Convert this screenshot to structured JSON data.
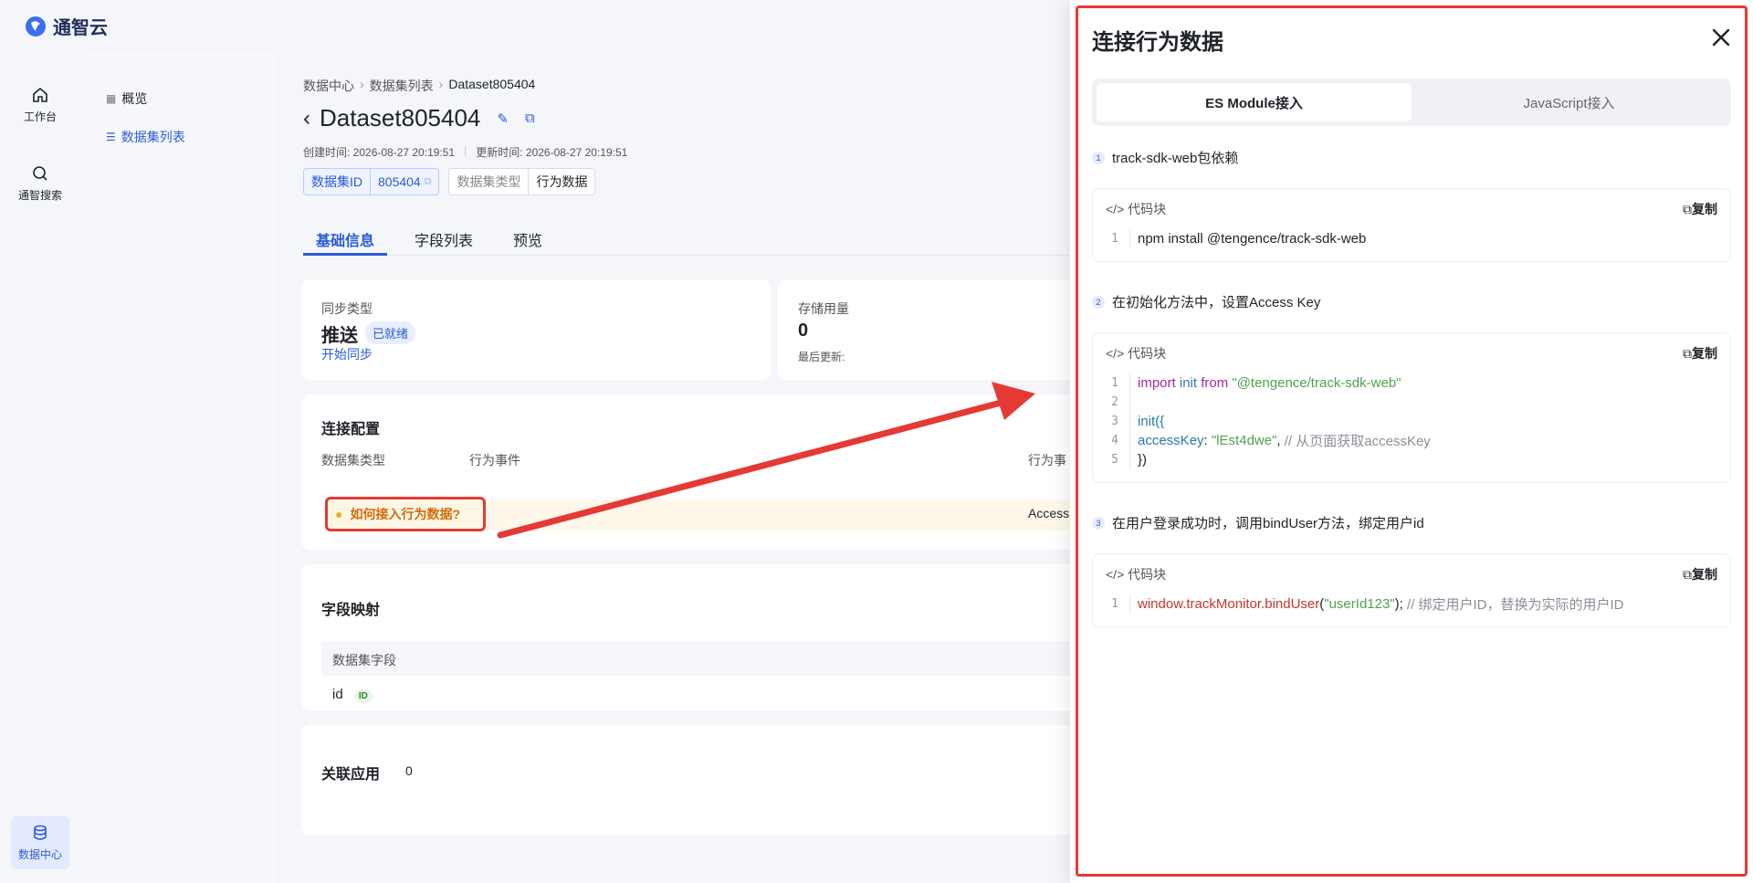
{
  "app": {
    "name": "通智云"
  },
  "rail": {
    "items": [
      {
        "label": "工作台",
        "icon": "home-icon"
      },
      {
        "label": "通智搜索",
        "icon": "search-icon"
      },
      {
        "label": "数据中心",
        "icon": "database-icon"
      }
    ]
  },
  "subnav": {
    "items": [
      "概览",
      "数据集列表"
    ]
  },
  "breadcrumb": [
    "数据中心",
    "数据集列表",
    "Dataset805404"
  ],
  "page": {
    "title": "Dataset805404",
    "created": "创建时间: 2026-08-27 20:19:51",
    "updated": "更新时间: 2026-08-27 20:19:51",
    "tag_id_key": "数据集ID",
    "tag_id_val": "805404",
    "tag_type_key": "数据集类型",
    "tag_type_val": "行为数据"
  },
  "tabs": [
    "基础信息",
    "字段列表",
    "预览"
  ],
  "sync": {
    "label": "同步类型",
    "value": "推送",
    "status": "已就绪",
    "action": "开始同步"
  },
  "storage": {
    "label": "存储用量",
    "value": "0",
    "last_update": "最后更新:"
  },
  "connect": {
    "title": "连接配置",
    "col_type": "数据集类型",
    "col_event": "行为事件",
    "col_event2": "行为事",
    "howto": "如何接入行为数据?",
    "access": "Access"
  },
  "mapping": {
    "title": "字段映射",
    "col": "数据集字段",
    "row_field": "id",
    "row_badge": "ID"
  },
  "related": {
    "title": "关联应用",
    "count": "0"
  },
  "drawer": {
    "title": "连接行为数据",
    "tab_es": "ES Module接入",
    "tab_js": "JavaScript接入",
    "code_label": "代码块",
    "copy_label": "复制",
    "steps": [
      {
        "num": "1",
        "text": "track-sdk-web包依赖"
      },
      {
        "num": "2",
        "text": "在初始化方法中，设置Access Key"
      },
      {
        "num": "3",
        "text": "在用户登录成功时，调用bindUser方法，绑定用户id"
      }
    ],
    "code1": {
      "l1": "npm install @tengence/track-sdk-web"
    },
    "code2": {
      "l1_kw": "import",
      "l1_name": " init ",
      "l1_from": "from",
      "l1_str": " \"@tengence/track-sdk-web\"",
      "l3": "init({",
      "l4_prop": "accessKey",
      "l4_colon": ": ",
      "l4_str": "\"lEst4dwe\"",
      "l4_comma": ", ",
      "l4_cm": "// 从页面获取accessKey",
      "l5": "})"
    },
    "code3": {
      "fn": "window.trackMonitor.bindUser",
      "open": "(",
      "str": "\"userId123\"",
      "close": "); ",
      "cm": "// 绑定用户ID，替换为实际的用户ID"
    }
  }
}
